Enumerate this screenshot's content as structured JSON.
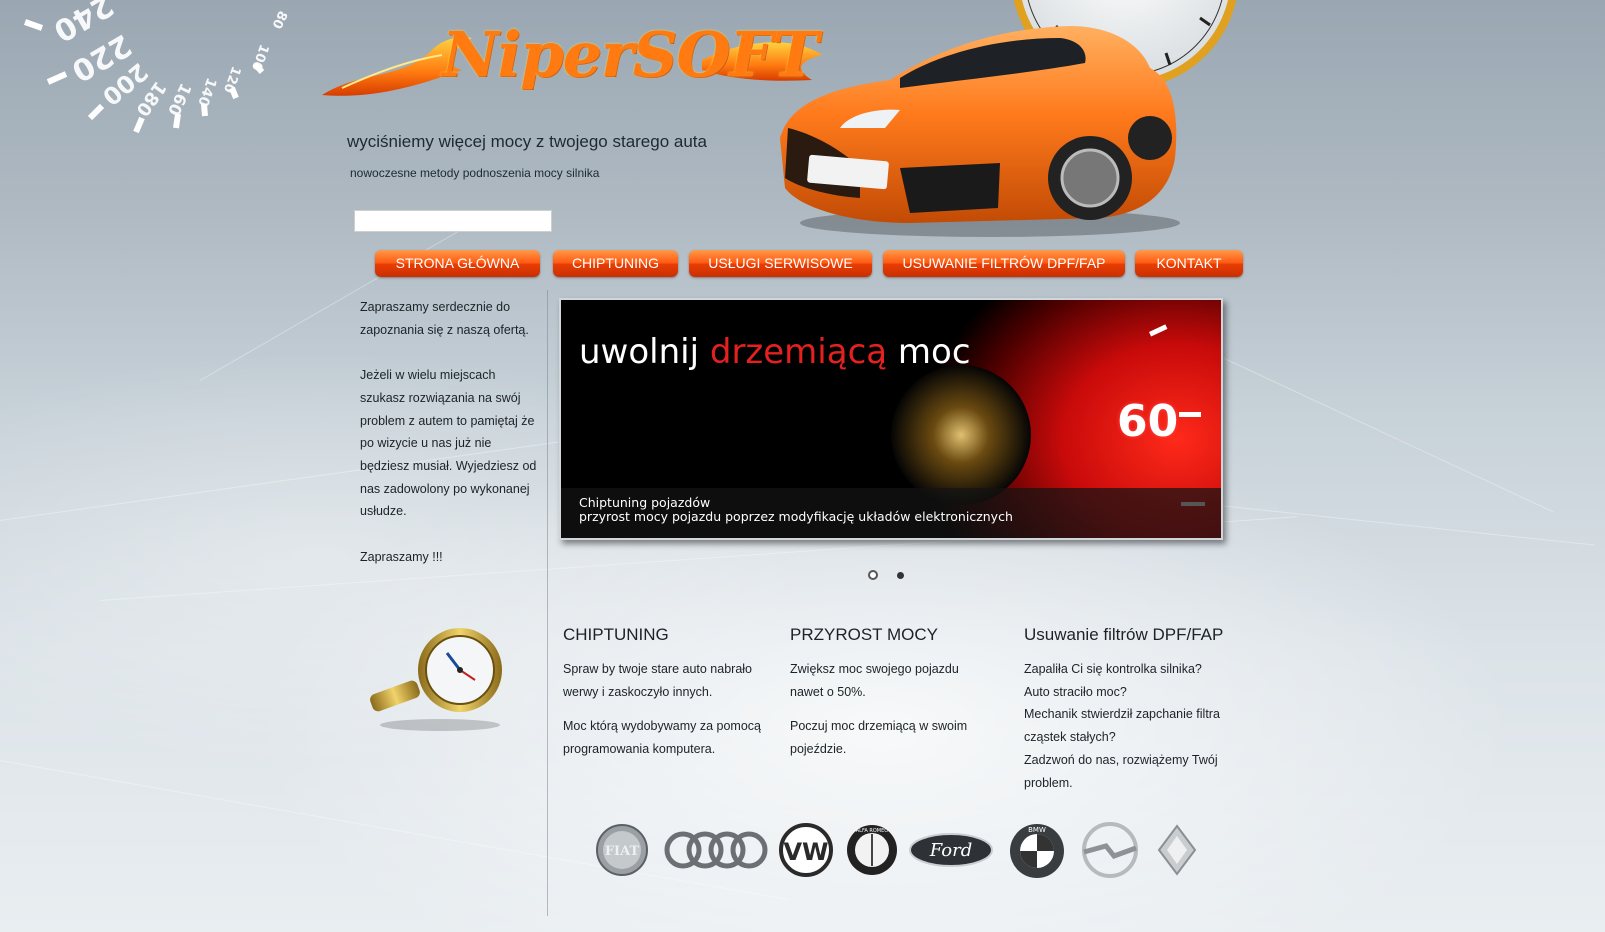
{
  "logo": {
    "text": "NiperSOFT"
  },
  "tagline": "wyciśniemy więcej mocy z twojego starego auta",
  "subtagline": "nowoczesne metody podnoszenia mocy silnika",
  "search": {
    "value": "",
    "placeholder": ""
  },
  "speedometer": {
    "numbers": [
      "240",
      "220",
      "200",
      "180",
      "160",
      "140",
      "120",
      "100",
      "80"
    ]
  },
  "nav": {
    "items": [
      {
        "label": "STRONA GŁÓWNA"
      },
      {
        "label": "CHIPTUNING"
      },
      {
        "label": "USŁUGI SERWISOWE"
      },
      {
        "label": "USUWANIE FILTRÓW DPF/FAP"
      },
      {
        "label": "KONTAKT"
      }
    ]
  },
  "intro": {
    "p1": "Zapraszamy serdecznie do zapoznania się z naszą ofertą.",
    "p2": "Jeżeli w wielu miejscach szukasz rozwiązania na swój problem z autem to pamiętaj że po wizycie u nas już nie będziesz musiał. Wyjedziesz od nas zadowolony po wykonanej usłudze.",
    "p3": "Zapraszamy !!!"
  },
  "slider": {
    "heading_part1": "uwolnij ",
    "heading_red": "drzemiącą",
    "heading_part2": " moc",
    "gauge_number": "60",
    "caption_line1": "Chiptuning pojazdów",
    "caption_line2": "przyrost mocy pojazdu poprzez modyfikację układów elektronicznych",
    "slides_count": 2,
    "active_slide": 1
  },
  "columns": [
    {
      "title": "CHIPTUNING",
      "paragraphs": [
        "Spraw by twoje stare auto nabrało werwy i zaskoczyło innych.",
        "Moc którą wydobywamy za pomocą  programowania komputera."
      ]
    },
    {
      "title": "PRZYROST MOCY",
      "paragraphs": [
        "Zwiększ moc swojego pojazdu nawet o 50%.",
        "Poczuj moc drzemiącą w swoim pojeździe."
      ]
    },
    {
      "title": "Usuwanie filtrów DPF/FAP",
      "paragraphs": [
        "Zapaliła Ci się kontrolka silnika?",
        "Auto straciło moc?",
        "Mechanik stwierdził zapchanie filtra cząstek stałych?",
        "Zadzwoń do nas, rozwiążemy Twój problem."
      ]
    }
  ],
  "brands": {
    "fiat": "FIAT",
    "vw": "VW",
    "alfa": "ALFA ROMEO",
    "ford": "Ford",
    "bmw": "BMW"
  },
  "colors": {
    "accent": "#ff5a12",
    "slide_red": "#e4211e"
  }
}
